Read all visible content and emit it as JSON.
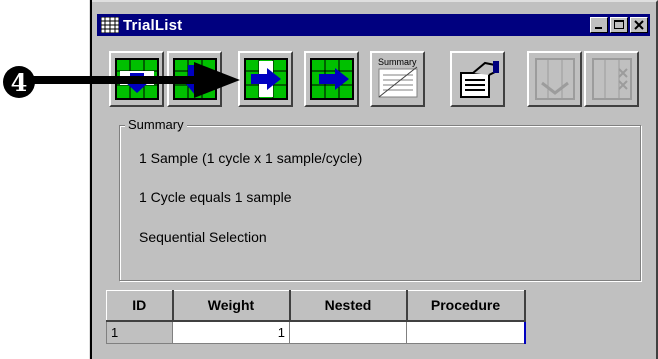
{
  "callout": {
    "number": "4"
  },
  "window": {
    "title": "TrialList",
    "controls": [
      "minimize",
      "maximize",
      "close"
    ]
  },
  "toolbar": {
    "buttons": [
      {
        "name": "insert-down-icon",
        "enabled": true
      },
      {
        "name": "append-down-icon",
        "enabled": true
      },
      {
        "name": "insert-right-icon",
        "enabled": true
      },
      {
        "name": "append-right-icon",
        "enabled": true
      },
      {
        "name": "summary-icon",
        "label": "Summary",
        "enabled": true
      },
      {
        "name": "properties-icon",
        "enabled": true
      },
      {
        "name": "nest-disabled-icon",
        "enabled": false
      },
      {
        "name": "remove-disabled-icon",
        "enabled": false
      }
    ]
  },
  "summary": {
    "legend": "Summary",
    "lines": [
      "1 Sample (1 cycle x 1 sample/cycle)",
      "1 Cycle equals 1 sample",
      "Sequential Selection"
    ]
  },
  "grid": {
    "columns": [
      "ID",
      "Weight",
      "Nested",
      "Procedure"
    ],
    "rows": [
      {
        "id": "1",
        "weight": "1",
        "nested": "",
        "procedure": ""
      }
    ]
  },
  "colors": {
    "titlebar": "#00007f",
    "face": "#c0c0c0",
    "icon_green": "#00c000",
    "icon_blue": "#0000c0"
  }
}
